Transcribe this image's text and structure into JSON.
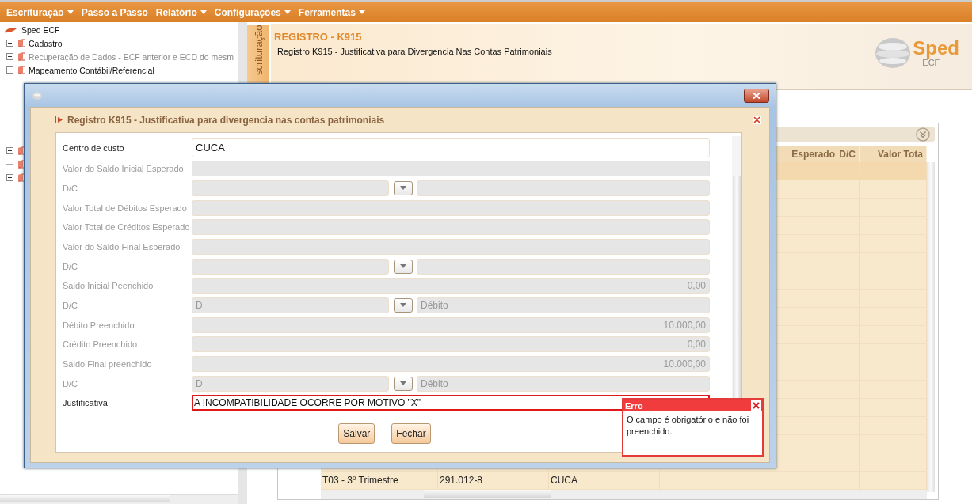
{
  "menu": [
    {
      "label": "Escrituração",
      "dropdown": true
    },
    {
      "label": "Passo a Passo",
      "dropdown": false
    },
    {
      "label": "Relatório",
      "dropdown": true
    },
    {
      "label": "Configurações",
      "dropdown": true
    },
    {
      "label": "Ferramentas",
      "dropdown": true
    }
  ],
  "tree": {
    "label": "Sped ECF",
    "children": [
      {
        "label": "Cadastro",
        "expandable": true,
        "expanded": false,
        "disabled": false
      },
      {
        "label": "Recuperação de Dados - ECF anterior e ECD do mesm",
        "expandable": true,
        "expanded": false,
        "disabled": true
      },
      {
        "label": "Mapeamento Contábil/Referencial",
        "expandable": true,
        "expanded": true,
        "disabled": false
      },
      {
        "expandable": true,
        "expanded": false
      },
      {
        "expandable": false
      },
      {
        "expandable": true,
        "expanded": false
      }
    ]
  },
  "side_tab": {
    "label": "scrituração"
  },
  "banner": {
    "title": "REGISTRO - K915",
    "subtitle": "Registro K915 - Justificativa para Divergencia Nas Contas Patrimoniais",
    "logo": "Sped",
    "logo_sub": "ECF"
  },
  "table": {
    "headers": [
      "Esperado",
      "D/C",
      "Valor Tota"
    ],
    "rows": [
      {
        "selected": true
      },
      {
        "selected": false
      },
      {
        "selected": false
      },
      {
        "selected": false
      },
      {
        "selected": false
      },
      {
        "selected": false
      },
      {
        "selected": false
      },
      {
        "selected": false
      },
      {
        "selected": false
      },
      {
        "selected": false
      },
      {
        "selected": false
      },
      {
        "selected": false
      },
      {
        "selected": false
      },
      {
        "selected": false
      },
      {
        "selected": false
      },
      {
        "selected": false
      },
      {
        "selected": false
      },
      {
        "selected": false,
        "cells": [
          "T03 - 3º Trimestre",
          "291.012-8",
          "CUCA"
        ]
      }
    ]
  },
  "dialog": {
    "title": "Registro K915 - Justificativa para divergencia nas contas patrimoniais",
    "fields": [
      {
        "kind": "text",
        "label": "Centro de custo",
        "value": "CUCA",
        "disabled": false,
        "error": false
      },
      {
        "kind": "text",
        "label": "Valor do Saldo Inicial Esperado",
        "disabled": true
      },
      {
        "kind": "dc",
        "label": "D/C",
        "disabled": true
      },
      {
        "kind": "text",
        "label": "Valor Total de Débitos Esperado",
        "disabled": true
      },
      {
        "kind": "text",
        "label": "Valor Total de Créditos Esperado",
        "disabled": true
      },
      {
        "kind": "text",
        "label": "Valor do Saldo Final Esperado",
        "disabled": true
      },
      {
        "kind": "dc",
        "label": "D/C",
        "disabled": true
      },
      {
        "kind": "number",
        "label": "Saldo Inicial Peenchido",
        "value": "0,00",
        "disabled": true
      },
      {
        "kind": "dc",
        "label": "D/C",
        "code": "D",
        "description": "Débito",
        "disabled": true
      },
      {
        "kind": "number",
        "label": "Débito Preenchido",
        "value": "10.000,00",
        "disabled": true
      },
      {
        "kind": "number",
        "label": "Crédito Preenchido",
        "value": "0,00",
        "disabled": true
      },
      {
        "kind": "number",
        "label": "Saldo Final preenchido",
        "value": "10.000,00",
        "disabled": true
      },
      {
        "kind": "dc",
        "label": "D/C",
        "code": "D",
        "description": "Débito",
        "disabled": true
      },
      {
        "kind": "text",
        "label": "Justificativa",
        "value": "A INCOMPATIBILIDADE OCORRE POR MOTIVO \"X\"",
        "disabled": false,
        "error": true
      }
    ],
    "buttons": [
      "Salvar",
      "Fechar"
    ]
  },
  "error_popup": {
    "title": "Erro",
    "message": "O campo é obrigatório e não foi preenchido."
  }
}
